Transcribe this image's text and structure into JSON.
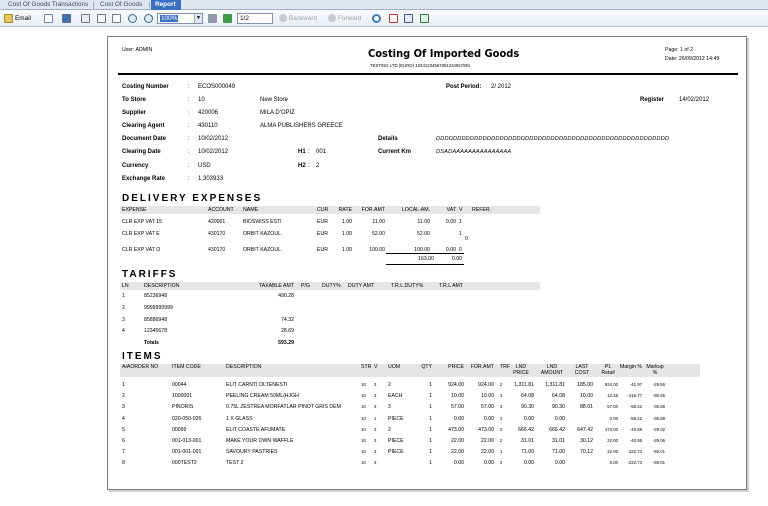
{
  "tabs": [
    "Cost Of Goods Transactions",
    "Cost Of Goods",
    "Report"
  ],
  "toolbar": {
    "email": "Email",
    "zoom": "100%",
    "page": "1/2",
    "backward": "Backward",
    "forward": "Forward"
  },
  "report": {
    "user": "User: ADMIN",
    "title": "Costing Of Imported Goods",
    "subtitle": "TESTING LTD (EURO) 12341234567891234567891",
    "page_label": "Page: 1 of 2",
    "date_label": "Date: 26/09/2012 14:49",
    "header": {
      "costing_number_label": "Costing Number",
      "costing_number": "ECOS000049",
      "post_period_label": "Post Period:",
      "post_period": "2/ 2012",
      "to_store_label": "To Store",
      "to_store_code": "10",
      "to_store_name": "New Store",
      "register_label": "Register",
      "register_date": "14/02/2012",
      "supplier_label": "Supplier",
      "supplier_code": "420006",
      "supplier_name": "MILA D'OPIZ",
      "clearing_agent_label": "Clearing Agent",
      "clearing_agent_code": "430110",
      "clearing_agent_name": "ALMA PUBLISHERS GREECE",
      "document_date_label": "Document Date",
      "document_date": "10/02/2012",
      "details_label": "Details",
      "details": "DDDDDDDDDDDDDDDDDDDDDDDDDDDDDDDDDDDDDDDDDDDDDDDDDDDDDDD",
      "clearing_date_label": "Clearing Date",
      "clearing_date": "10/02/2012",
      "h1_label": "H1",
      "h1": "001",
      "current_km_label": "Current Km",
      "current_km": "DSADAAAAAAAAAAAAAAA",
      "currency_label": "Currency",
      "currency": "USD",
      "h2_label": "H2",
      "h2": "2",
      "exchange_rate_label": "Exchange Rate",
      "exchange_rate": "1.303933"
    },
    "expenses": {
      "title": "DELIVERY EXPENSES",
      "columns": [
        "EXPENSE",
        "ACCOUNT",
        "NAME",
        "CUR",
        "RATE",
        "FOR.AMT",
        "LOCAL-AM.",
        "VAT",
        "V",
        "REFER."
      ],
      "rows": [
        [
          "CLR EXP VAT 15",
          "420001",
          "BIOSWISS ESTHETIC S",
          "EUR",
          "1.00",
          "11.00",
          "11.00",
          "0.00",
          "1",
          ""
        ],
        [
          "CLR EXP VAT E",
          "430170",
          "ORBIT KAZOULIS GROU",
          "EUR",
          "1.00",
          "52.00",
          "52.00",
          "",
          "1",
          ""
        ],
        [
          "CLR EXP VAT O",
          "430170",
          "ORBIT KAZOULIS GROU",
          "EUR",
          "1.00",
          "100.00",
          "100.00",
          "0.00",
          "0",
          ""
        ]
      ],
      "extra_v": "0",
      "total_local": "163.00",
      "total_vat": "0.00"
    },
    "tariffs": {
      "title": "TARIFFS",
      "columns": [
        "LN",
        "DESCRIPTION",
        "TAXABLE AMT",
        "P/G",
        "DUTY%",
        "DUTY AMT",
        "T.R.L.DUTY%",
        "T.R.L AMT"
      ],
      "rows": [
        [
          "1",
          "85236948",
          "490.28"
        ],
        [
          "2",
          "9999999999",
          ""
        ],
        [
          "3",
          "85886948",
          "74.32"
        ],
        [
          "4",
          "12345678",
          "28.69"
        ]
      ],
      "totals_label": "Totals",
      "totals_value": "593.29"
    },
    "items": {
      "title": "ITEMS",
      "columns": [
        "A/AORDER NO",
        "ITEM CODE",
        "DESCRIPTION",
        "STR",
        "V",
        "UOM",
        "QTY",
        "PRICE",
        "FOR.AMT",
        "TRF",
        "LND PRICE",
        "LND AMOUNT",
        "LAST COST",
        "P1 Retail",
        "Margin %",
        "Markup %"
      ],
      "rows": [
        [
          "1",
          "00044",
          "ELIT CARNTI OLTENESTI",
          "10",
          "3",
          "2",
          "1",
          "924.00",
          "924.00",
          "2",
          "1,311.81",
          "1,311.81",
          "185.00",
          "924.00",
          "-41.97",
          "-29.56"
        ],
        [
          "2",
          "1000001",
          "PEELING CREAM 50ML(HJGH",
          "10",
          "3",
          "EACH",
          "1",
          "10.00",
          "10.00",
          "3",
          "64.08",
          "64.08",
          "10.00",
          "12.48",
          "-416.77",
          "-80.65"
        ],
        [
          "3",
          "PINORIS",
          "0.75L ZESTREA MORFATLAR PINOT GRIS DEM",
          "10",
          "3",
          "3",
          "1",
          "57.00",
          "57.00",
          "3",
          "90.30",
          "90.30",
          "88.01",
          "57.00",
          "-58.42",
          "-36.88"
        ],
        [
          "4",
          "020-050-026",
          "1 X GLASS",
          "10",
          "1",
          "PIECE",
          "1",
          "0.00",
          "0.00",
          "2",
          "0.00",
          "0.00",
          "",
          "0.00",
          "-58.42",
          "-36.88"
        ],
        [
          "5",
          "00099",
          "ELIT COASTE AFUMATE",
          "10",
          "3",
          "2",
          "1",
          "473.00",
          "473.00",
          "2",
          "666.42",
          "666.42",
          "647.42",
          "473.00",
          "-40.89",
          "-29.02"
        ],
        [
          "6",
          "001-013-001",
          "MAKE YOUR OWN WAFFLE",
          "10",
          "3",
          "PIECE",
          "1",
          "22.00",
          "22.00",
          "2",
          "31.01",
          "31.01",
          "30.12",
          "22.00",
          "-40.95",
          "-29.06"
        ],
        [
          "7",
          "001-001-001",
          "SAVOURY PASTRIES",
          "10",
          "3",
          "PIECE",
          "1",
          "22.00",
          "22.00",
          "1",
          "71.00",
          "71.00",
          "70.12",
          "22.00",
          "-222.73",
          "-69.01"
        ],
        [
          "8",
          "000TEST2",
          "TEST 2",
          "10",
          "3",
          "",
          "1",
          "0.00",
          "0.00",
          "2",
          "0.00",
          "0.00",
          "",
          "0.00",
          "-222.73",
          "-69.01"
        ]
      ]
    }
  }
}
